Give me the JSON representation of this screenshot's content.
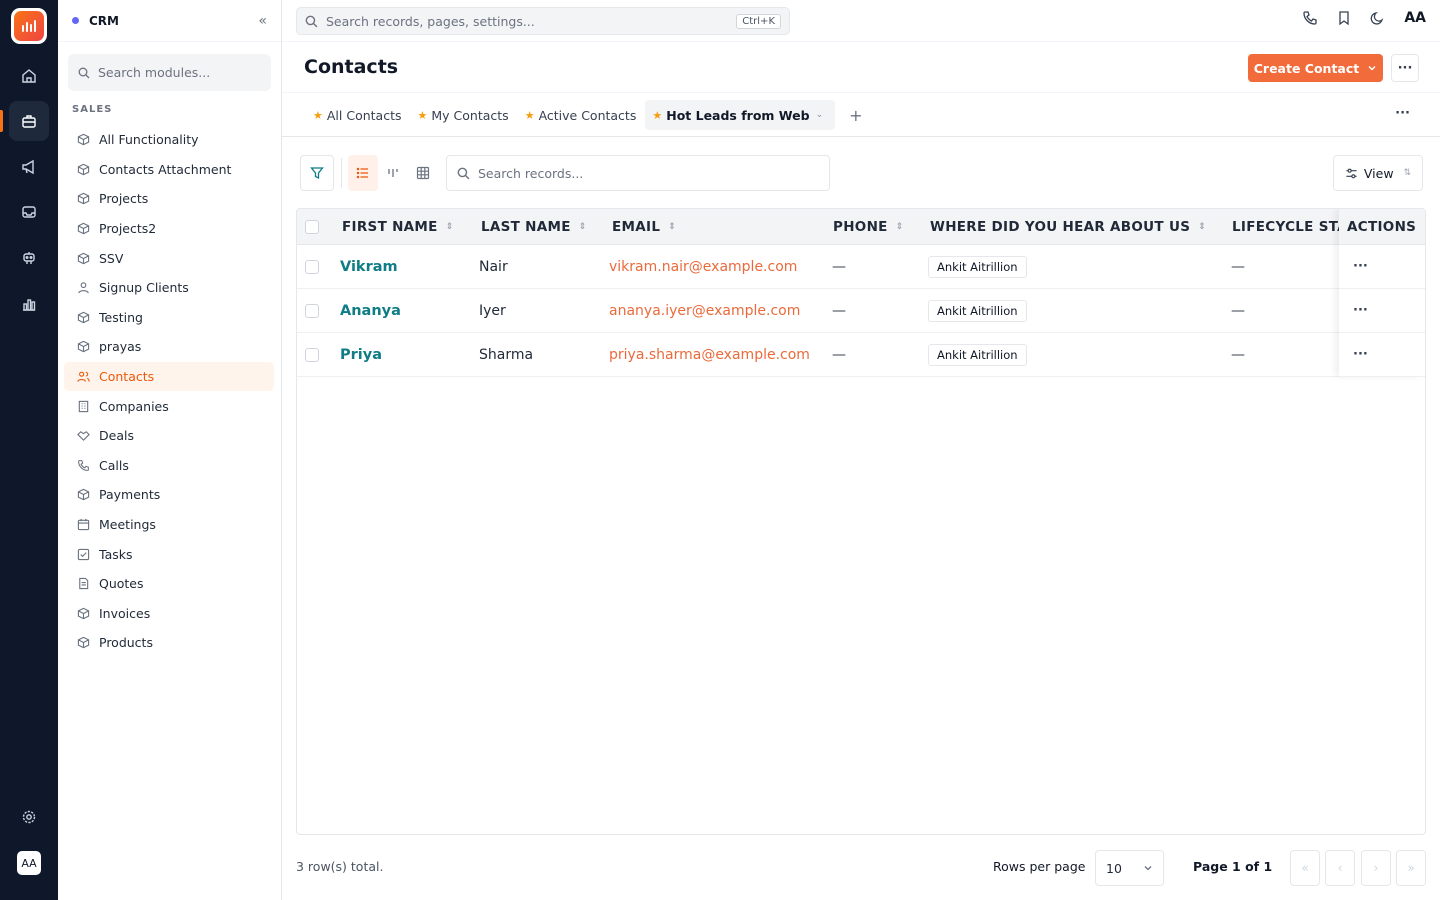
{
  "app": {
    "module_name": "CRM",
    "accent": "#f26b3a"
  },
  "rail": {
    "items": [
      {
        "icon": "home-icon"
      },
      {
        "icon": "briefcase-icon",
        "active": true
      },
      {
        "icon": "megaphone-icon"
      },
      {
        "icon": "inbox-icon"
      },
      {
        "icon": "robot-icon"
      },
      {
        "icon": "bar-chart-icon"
      }
    ],
    "settings_icon": "gear-icon",
    "avatar": "AA"
  },
  "sidebar": {
    "search_placeholder": "Search modules...",
    "section": "SALES",
    "items": [
      {
        "label": "All Functionality",
        "icon": "cube-icon"
      },
      {
        "label": "Contacts Attachment",
        "icon": "cube-icon"
      },
      {
        "label": "Projects",
        "icon": "cube-icon"
      },
      {
        "label": "Projects2",
        "icon": "cube-icon"
      },
      {
        "label": "SSV",
        "icon": "cube-icon"
      },
      {
        "label": "Signup Clients",
        "icon": "user-icon"
      },
      {
        "label": "Testing",
        "icon": "cube-icon"
      },
      {
        "label": "prayas",
        "icon": "cube-icon"
      },
      {
        "label": "Contacts",
        "icon": "users-icon",
        "active": true
      },
      {
        "label": "Companies",
        "icon": "building-icon"
      },
      {
        "label": "Deals",
        "icon": "handshake-icon"
      },
      {
        "label": "Calls",
        "icon": "phone-icon"
      },
      {
        "label": "Payments",
        "icon": "cube-icon"
      },
      {
        "label": "Meetings",
        "icon": "calendar-icon"
      },
      {
        "label": "Tasks",
        "icon": "checkbox-icon"
      },
      {
        "label": "Quotes",
        "icon": "document-icon"
      },
      {
        "label": "Invoices",
        "icon": "cube-icon"
      },
      {
        "label": "Products",
        "icon": "cube-icon"
      }
    ]
  },
  "topbar": {
    "search_placeholder": "Search records, pages, settings...",
    "shortcut": "Ctrl+K",
    "avatar": "AA"
  },
  "page": {
    "title": "Contacts",
    "create_label": "Create Contact"
  },
  "tabs": [
    {
      "label": "All Contacts"
    },
    {
      "label": "My Contacts"
    },
    {
      "label": "Active Contacts"
    },
    {
      "label": "Hot Leads from Web",
      "active": true
    }
  ],
  "toolbar": {
    "search_placeholder": "Search records...",
    "view_label": "View"
  },
  "table": {
    "columns": [
      "FIRST NAME",
      "LAST NAME",
      "EMAIL",
      "PHONE",
      "WHERE DID YOU HEAR ABOUT US",
      "LIFECYCLE STAGE",
      "ACTIONS"
    ],
    "rows": [
      {
        "first": "Vikram",
        "last": "Nair",
        "email": "vikram.nair@example.com",
        "phone": "—",
        "source": "Ankit Aitrillion",
        "lifecycle": "—"
      },
      {
        "first": "Ananya",
        "last": "Iyer",
        "email": "ananya.iyer@example.com",
        "phone": "—",
        "source": "Ankit Aitrillion",
        "lifecycle": "—"
      },
      {
        "first": "Priya",
        "last": "Sharma",
        "email": "priya.sharma@example.com",
        "phone": "—",
        "source": "Ankit Aitrillion",
        "lifecycle": "—"
      }
    ]
  },
  "footer": {
    "total": "3 row(s) total.",
    "rows_per_page_label": "Rows per page",
    "rows_per_page": "10",
    "page_label": "Page 1 of 1"
  }
}
